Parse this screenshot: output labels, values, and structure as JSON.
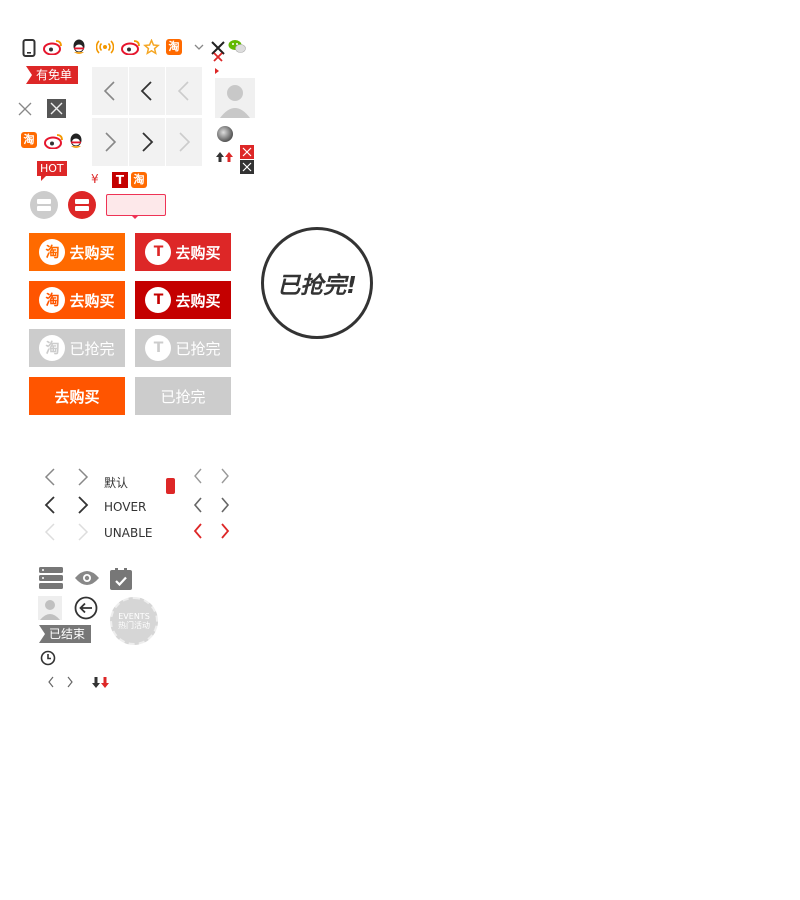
{
  "colors": {
    "orange": "#ff6a00",
    "red": "#dd2727",
    "dark_red": "#c40000",
    "gray_btn": "#cccccc",
    "gray_text": "#999999"
  },
  "ribbons": {
    "free": "有免单",
    "hot": "HOT",
    "ended": "已结束"
  },
  "glyphs": {
    "tao": "淘",
    "t_mall": "T",
    "yuan": "¥"
  },
  "buttons": {
    "buy": "去购买",
    "sold_out": "已抢完"
  },
  "stamp": {
    "sold_out": "已抢完!"
  },
  "nav_states": {
    "default": "默认",
    "hover": "HOVER",
    "unable": "UNABLE"
  },
  "events_badge": {
    "line1": "EVENTS",
    "line2": "热门活动"
  },
  "icons": [
    "phone-icon",
    "weibo-icon",
    "qq-icon",
    "broadcast-icon",
    "star-icon",
    "tao-icon",
    "wechat-icon",
    "close-icon",
    "eye-icon",
    "clock-icon",
    "back-circle-icon",
    "avatar-icon",
    "checklist-icon"
  ]
}
